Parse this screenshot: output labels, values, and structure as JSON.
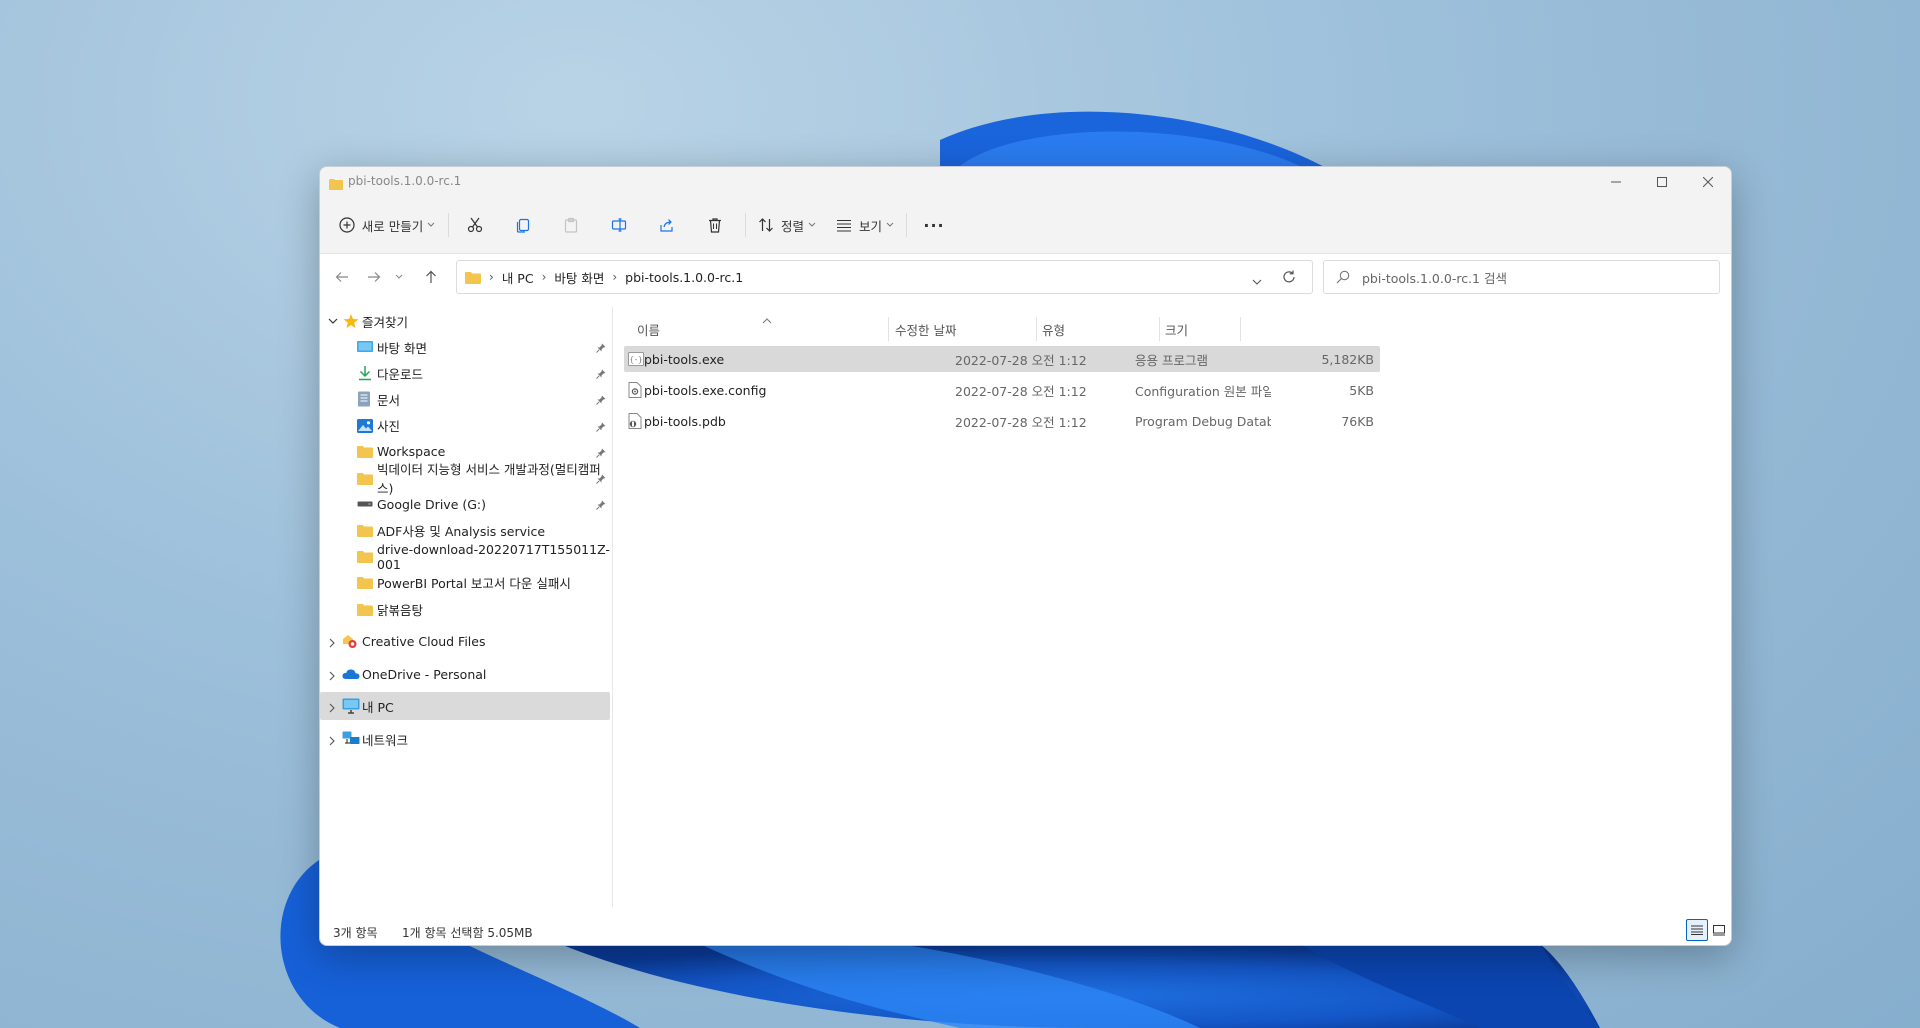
{
  "window": {
    "title": "pbi-tools.1.0.0-rc.1"
  },
  "toolbar": {
    "new_label": "새로 만들기",
    "sort_label": "정렬",
    "view_label": "보기",
    "more_label": "···"
  },
  "address": {
    "crumbs": [
      "내 PC",
      "바탕 화면",
      "pbi-tools.1.0.0-rc.1"
    ]
  },
  "search": {
    "placeholder": "pbi-tools.1.0.0-rc.1 검색"
  },
  "sidebar": {
    "favorites_label": "즐겨찾기",
    "favorites": [
      {
        "label": "바탕 화면",
        "icon": "desktop-icon",
        "pinned": true
      },
      {
        "label": "다운로드",
        "icon": "download-icon",
        "pinned": true
      },
      {
        "label": "문서",
        "icon": "document-icon",
        "pinned": true
      },
      {
        "label": "사진",
        "icon": "picture-icon",
        "pinned": true
      },
      {
        "label": "Workspace",
        "icon": "folder-icon",
        "pinned": true
      },
      {
        "label": "빅데이터 지능형 서비스 개발과정(멀티캠퍼스)",
        "icon": "folder-icon",
        "pinned": true
      },
      {
        "label": "Google Drive (G:)",
        "icon": "drive-icon",
        "pinned": true
      },
      {
        "label": "ADF사용 및 Analysis service",
        "icon": "folder-icon",
        "pinned": false
      },
      {
        "label": "drive-download-20220717T155011Z-001",
        "icon": "folder-icon",
        "pinned": false
      },
      {
        "label": "PowerBI Portal 보고서 다운 실패시",
        "icon": "folder-icon",
        "pinned": false
      },
      {
        "label": "닭볶음탕",
        "icon": "folder-icon",
        "pinned": false
      }
    ],
    "groups": [
      {
        "label": "Creative Cloud Files",
        "icon": "creative-cloud-icon"
      },
      {
        "label": "OneDrive - Personal",
        "icon": "onedrive-icon"
      },
      {
        "label": "내 PC",
        "icon": "pc-icon",
        "selected": true
      },
      {
        "label": "네트워크",
        "icon": "network-icon"
      }
    ]
  },
  "list": {
    "columns": {
      "name": "이름",
      "date": "수정한 날짜",
      "type": "유형",
      "size": "크기"
    },
    "files": [
      {
        "name": "pbi-tools.exe",
        "date": "2022-07-28 오전 1:12",
        "type": "응용 프로그램",
        "size": "5,182KB",
        "icon": "exe-icon",
        "selected": true
      },
      {
        "name": "pbi-tools.exe.config",
        "date": "2022-07-28 오전 1:12",
        "type": "Configuration 원본 파일",
        "size": "5KB",
        "icon": "config-file-icon",
        "selected": false
      },
      {
        "name": "pbi-tools.pdb",
        "date": "2022-07-28 오전 1:12",
        "type": "Program Debug Datab...",
        "size": "76KB",
        "icon": "pdb-file-icon",
        "selected": false
      }
    ]
  },
  "status": {
    "count": "3개 항목",
    "selection": "1개 항목 선택함 5.05MB"
  },
  "colors": {
    "folder": "#f3c54e",
    "accent": "#0067c0",
    "selected_row": "#d9d9d9"
  }
}
